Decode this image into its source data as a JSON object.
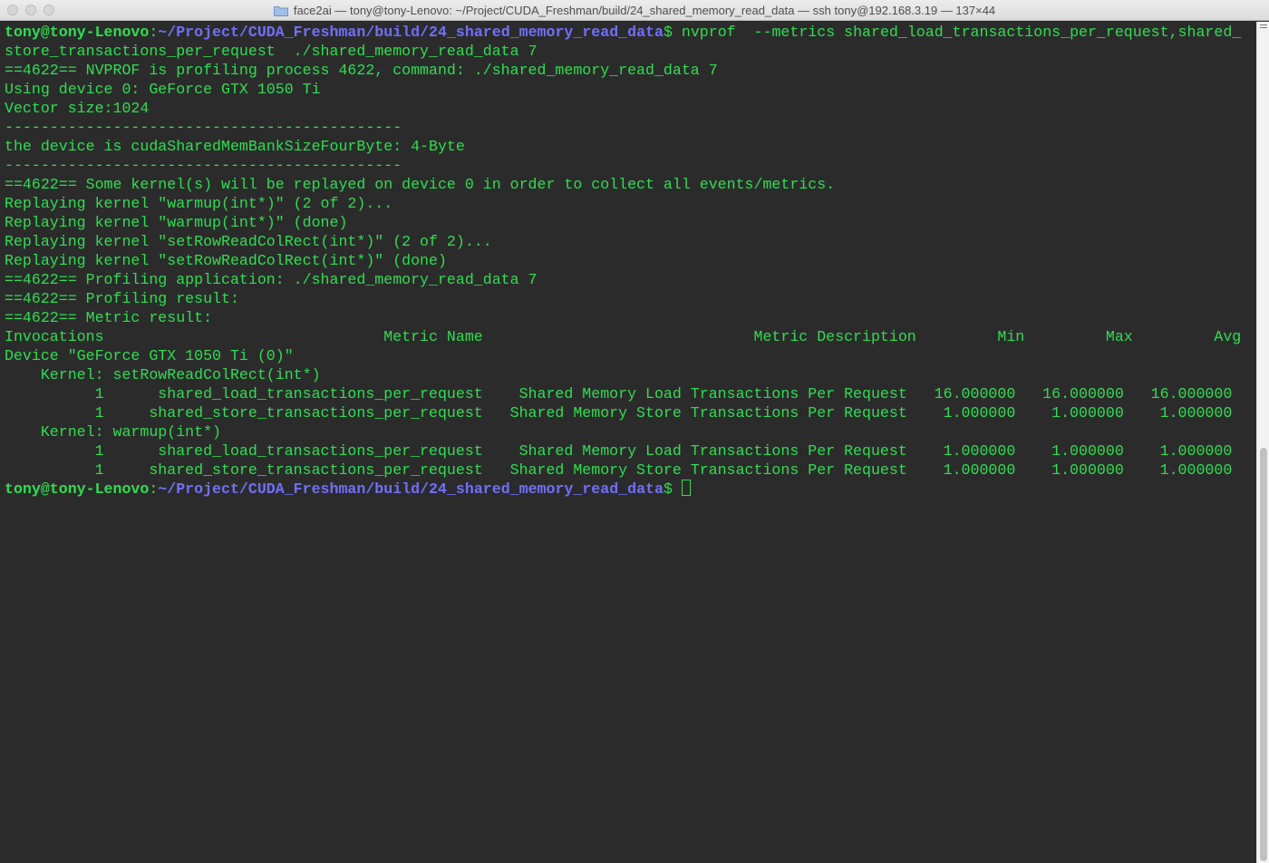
{
  "window": {
    "title": "face2ai — tony@tony-Lenovo: ~/Project/CUDA_Freshman/build/24_shared_memory_read_data — ssh tony@192.168.3.19 — 137×44"
  },
  "prompt": {
    "user": "tony@tony-Lenovo",
    "sep": ":",
    "path": "~/Project/CUDA_Freshman/build/24_shared_memory_read_data",
    "sign": "$ "
  },
  "lines": {
    "cmd1": "nvprof  --metrics shared_load_transactions_per_request,shared_",
    "cmd2": "store_transactions_per_request  ./shared_memory_read_data 7",
    "l3": "==4622== NVPROF is profiling process 4622, command: ./shared_memory_read_data 7",
    "l4": "Using device 0: GeForce GTX 1050 Ti",
    "l5": "Vector size:1024",
    "l6": "--------------------------------------------",
    "l7": "the device is cudaSharedMemBankSizeFourByte: 4-Byte",
    "l8": "--------------------------------------------",
    "l9": "==4622== Some kernel(s) will be replayed on device 0 in order to collect all events/metrics.",
    "l10": "Replaying kernel \"warmup(int*)\" (2 of 2)...",
    "l11": "Replaying kernel \"warmup(int*)\" (done)",
    "l12": "Replaying kernel \"setRowReadColRect(int*)\" (2 of 2)...",
    "l13": "Replaying kernel \"setRowReadColRect(int*)\" (done)",
    "l14": "==4622== Profiling application: ./shared_memory_read_data 7",
    "l15": "==4622== Profiling result:",
    "l16": "==4622== Metric result:",
    "l17": "Invocations                               Metric Name                              Metric Description         Min         Max         Avg",
    "l18": "Device \"GeForce GTX 1050 Ti (0)\"",
    "l19": "    Kernel: setRowReadColRect(int*)",
    "l20": "          1      shared_load_transactions_per_request    Shared Memory Load Transactions Per Request   16.000000   16.000000   16.000000",
    "l21": "          1     shared_store_transactions_per_request   Shared Memory Store Transactions Per Request    1.000000    1.000000    1.000000",
    "l22": "    Kernel: warmup(int*)",
    "l23": "          1      shared_load_transactions_per_request    Shared Memory Load Transactions Per Request    1.000000    1.000000    1.000000",
    "l24": "          1     shared_store_transactions_per_request   Shared Memory Store Transactions Per Request    1.000000    1.000000    1.000000"
  }
}
